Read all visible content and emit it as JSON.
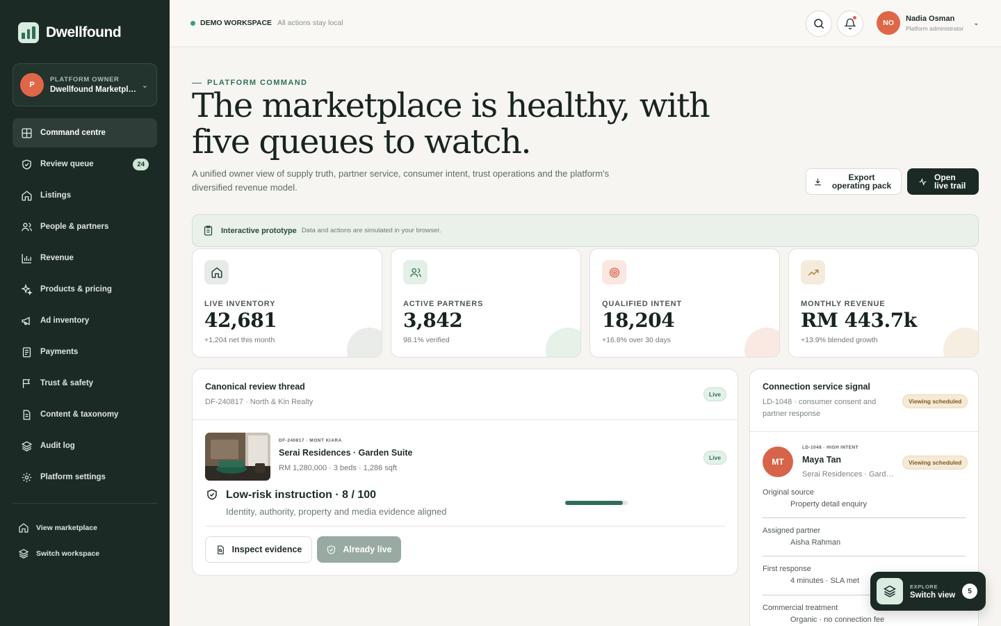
{
  "brand": {
    "name": "Dwellfound"
  },
  "workspace": {
    "avatar": "P",
    "role": "PLATFORM OWNER",
    "name": "Dwellfound Marketplace"
  },
  "nav": [
    {
      "label": "Command centre",
      "icon": "grid-icon",
      "active": true
    },
    {
      "label": "Review queue",
      "icon": "shield-check-icon",
      "badge": "24"
    },
    {
      "label": "Listings",
      "icon": "home-icon"
    },
    {
      "label": "People & partners",
      "icon": "users-icon"
    },
    {
      "label": "Revenue",
      "icon": "bar-chart-icon"
    },
    {
      "label": "Products & pricing",
      "icon": "sparkles-icon"
    },
    {
      "label": "Ad inventory",
      "icon": "megaphone-icon"
    },
    {
      "label": "Payments",
      "icon": "receipt-icon"
    },
    {
      "label": "Trust & safety",
      "icon": "flag-icon"
    },
    {
      "label": "Content & taxonomy",
      "icon": "document-icon"
    },
    {
      "label": "Audit log",
      "icon": "layers-icon"
    },
    {
      "label": "Platform settings",
      "icon": "gear-icon"
    }
  ],
  "nav_secondary": [
    {
      "label": "View marketplace",
      "icon": "home-icon"
    },
    {
      "label": "Switch workspace",
      "icon": "layers-icon"
    }
  ],
  "topbar": {
    "demo_title": "DEMO WORKSPACE",
    "demo_sub": "All actions stay local",
    "user": {
      "initials": "NO",
      "name": "Nadia Osman",
      "role": "Platform administrator"
    }
  },
  "hero": {
    "kicker": "PLATFORM COMMAND",
    "headline": "The marketplace is healthy, with five queues to watch.",
    "lede": "A unified owner view of supply truth, partner service, consumer intent, trust operations and the platform's diversified revenue model.",
    "export_label": "Export operating pack",
    "trail_label": "Open live trail"
  },
  "banner": {
    "title": "Interactive prototype",
    "sub": "Data and actions are simulated in your browser."
  },
  "stats": [
    {
      "label": "LIVE INVENTORY",
      "value": "42,681",
      "sub": "+1,204 net this month",
      "icon": "home-icon",
      "color": "#e6ebe8",
      "blob": "#e9ece9"
    },
    {
      "label": "ACTIVE PARTNERS",
      "value": "3,842",
      "sub": "98.1% verified",
      "icon": "users-icon",
      "color": "#e3f0e6",
      "blob": "#e6f1e8"
    },
    {
      "label": "QUALIFIED INTENT",
      "value": "18,204",
      "sub": "+16.8% over 30 days",
      "icon": "target-icon",
      "color": "#fbe6e1",
      "blob": "#fae8e3"
    },
    {
      "label": "MONTHLY REVENUE",
      "value": "RM 443.7k",
      "sub": "+13.9% blended growth",
      "icon": "trend-up-icon",
      "color": "#f5ebdd",
      "blob": "#f7eee2"
    }
  ],
  "review": {
    "title": "Canonical review thread",
    "sub": "DF-240817 · North & Kin Realty",
    "status": "Live",
    "listing": {
      "meta": "DF-240817 · MONT KIARA",
      "name": "Serai Residences · Garden Suite",
      "details": "RM 1,280,000 · 3 beds · 1,286 sqft",
      "status": "Live"
    },
    "risk_title": "Low-risk instruction · 8 / 100",
    "risk_sub": "Identity, authority, property and media evidence aligned",
    "risk_score": 0.92,
    "inspect_label": "Inspect evidence",
    "live_label": "Already live"
  },
  "connection": {
    "title": "Connection service signal",
    "sub": "LD-1048 · consumer consent and partner response",
    "status": "Viewing scheduled",
    "lead": {
      "initials": "MT",
      "meta": "LD-1048 · HIGH INTENT",
      "name": "Maya Tan",
      "property": "Serai Residences · Garden Suite",
      "status": "Viewing scheduled"
    },
    "rows": [
      {
        "k": "Original source",
        "v": "Property detail enquiry"
      },
      {
        "k": "Assigned partner",
        "v": "Aisha Rahman"
      },
      {
        "k": "First response",
        "v": "4 minutes · SLA met"
      },
      {
        "k": "Commercial treatment",
        "v": "Organic · no connection fee"
      }
    ]
  },
  "fab": {
    "kicker": "EXPLORE",
    "title": "Switch view",
    "count": "5"
  }
}
